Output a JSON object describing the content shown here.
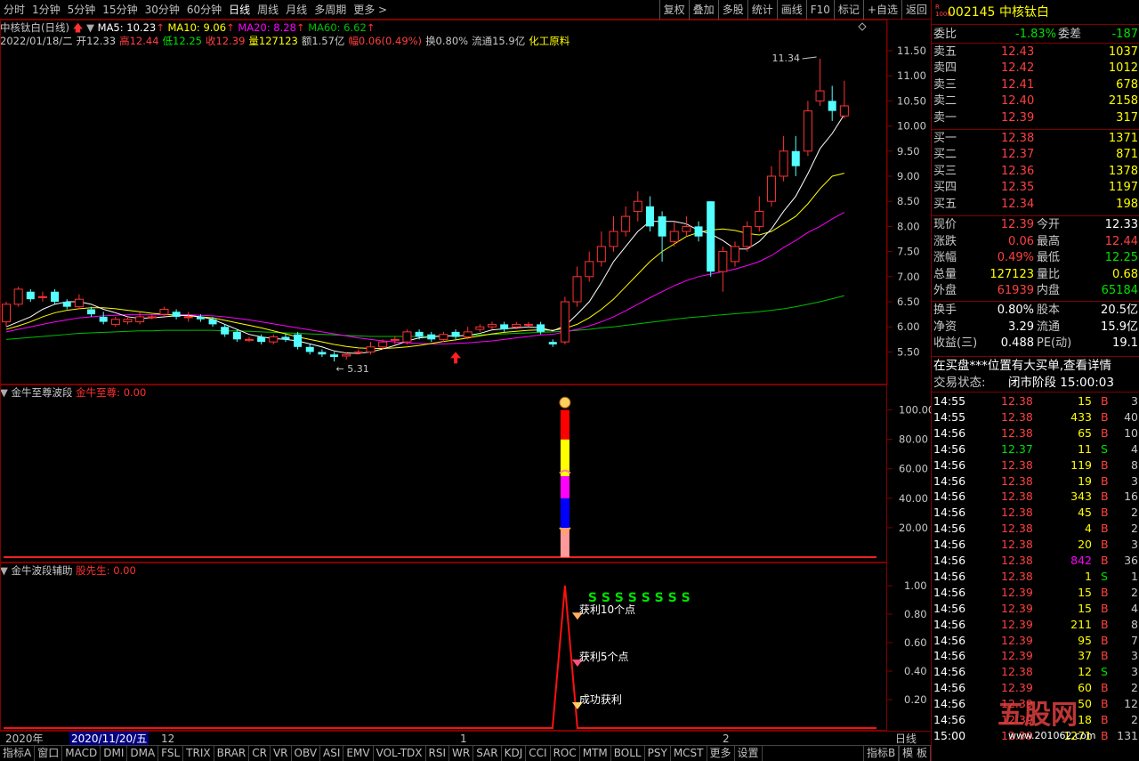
{
  "toolbar": {
    "periods": [
      "分时",
      "1分钟",
      "5分钟",
      "15分钟",
      "30分钟",
      "60分钟",
      "日线",
      "周线",
      "月线",
      "多周期",
      "更多 >"
    ],
    "active": "日线",
    "actions": [
      "复权",
      "叠加",
      "多股",
      "统计",
      "画线",
      "F10",
      "标记",
      "+自选",
      "返回"
    ]
  },
  "chart_header": {
    "name": "中核钛白(日线)",
    "ma5": "MA5: 10.23",
    "ma10": "MA10: 9.06",
    "ma20": "MA20: 8.28",
    "ma60": "MA60: 6.62",
    "info_line": [
      {
        "t": "2022/01/18/二",
        "c": "#c8c8c8"
      },
      {
        "t": "开12.33",
        "c": "#c8c8c8"
      },
      {
        "t": "高12.44",
        "c": "#ff4040"
      },
      {
        "t": "低12.25",
        "c": "#00e000"
      },
      {
        "t": "收12.39",
        "c": "#ff4040"
      },
      {
        "t": "量127123",
        "c": "#ffff00"
      },
      {
        "t": "额1.57亿",
        "c": "#c8c8c8"
      },
      {
        "t": "幅0.06(0.49%)",
        "c": "#ff4040"
      },
      {
        "t": "换0.80%",
        "c": "#c8c8c8"
      },
      {
        "t": "流通15.9亿",
        "c": "#c8c8c8"
      },
      {
        "t": "化工原料",
        "c": "#ffff00"
      }
    ],
    "high_label": "11.34",
    "low_label": "5.31"
  },
  "colors": {
    "up": "#ff3232",
    "down": "#54ffff",
    "ma5": "#ffffff",
    "ma10": "#ffff00",
    "ma20": "#ff00ff",
    "ma60": "#00c000",
    "frame": "#800000"
  },
  "chart_data": [
    {
      "type": "candlestick",
      "y_ticks": [
        11.5,
        11.0,
        10.5,
        10.0,
        9.5,
        9.0,
        8.5,
        8.0,
        7.5,
        7.0,
        6.5,
        6.0,
        5.5
      ],
      "ylim": [
        5.1,
        11.8
      ],
      "candles": [
        [
          6.1,
          6.45,
          6.5,
          6.0
        ],
        [
          6.45,
          6.75,
          6.8,
          6.4
        ],
        [
          6.7,
          6.55,
          6.75,
          6.5
        ],
        [
          6.6,
          6.6,
          6.7,
          6.5
        ],
        [
          6.7,
          6.5,
          6.75,
          6.45
        ],
        [
          6.5,
          6.4,
          6.55,
          6.35
        ],
        [
          6.4,
          6.55,
          6.65,
          6.35
        ],
        [
          6.35,
          6.25,
          6.4,
          6.2
        ],
        [
          6.2,
          6.1,
          6.3,
          6.05
        ],
        [
          6.05,
          6.15,
          6.2,
          6.0
        ],
        [
          6.1,
          6.15,
          6.2,
          6.05
        ],
        [
          6.1,
          6.2,
          6.3,
          6.05
        ],
        [
          6.2,
          6.2,
          6.25,
          6.15
        ],
        [
          6.25,
          6.35,
          6.4,
          6.2
        ],
        [
          6.3,
          6.2,
          6.35,
          6.15
        ],
        [
          6.2,
          6.2,
          6.3,
          6.1
        ],
        [
          6.2,
          6.15,
          6.25,
          6.1
        ],
        [
          6.15,
          6.05,
          6.2,
          6.0
        ],
        [
          6.0,
          5.85,
          6.05,
          5.8
        ],
        [
          5.9,
          5.75,
          5.95,
          5.7
        ],
        [
          5.75,
          5.75,
          5.8,
          5.7
        ],
        [
          5.8,
          5.7,
          5.85,
          5.65
        ],
        [
          5.7,
          5.8,
          5.85,
          5.65
        ],
        [
          5.8,
          5.75,
          5.85,
          5.7
        ],
        [
          5.85,
          5.6,
          5.9,
          5.55
        ],
        [
          5.6,
          5.5,
          5.65,
          5.45
        ],
        [
          5.5,
          5.45,
          5.55,
          5.4
        ],
        [
          5.45,
          5.4,
          5.5,
          5.31
        ],
        [
          5.42,
          5.45,
          5.5,
          5.35
        ],
        [
          5.5,
          5.5,
          5.55,
          5.45
        ],
        [
          5.5,
          5.6,
          5.7,
          5.45
        ],
        [
          5.6,
          5.7,
          5.75,
          5.55
        ],
        [
          5.75,
          5.75,
          5.8,
          5.65
        ],
        [
          5.7,
          5.9,
          5.95,
          5.65
        ],
        [
          5.9,
          5.8,
          5.95,
          5.75
        ],
        [
          5.85,
          5.75,
          5.9,
          5.7
        ],
        [
          5.75,
          5.85,
          5.9,
          5.7
        ],
        [
          5.9,
          5.8,
          5.95,
          5.75
        ],
        [
          5.8,
          5.9,
          6.0,
          5.75
        ],
        [
          5.95,
          6.0,
          6.05,
          5.9
        ],
        [
          6.0,
          6.05,
          6.1,
          5.95
        ],
        [
          6.05,
          5.95,
          6.1,
          5.9
        ],
        [
          6.0,
          6.05,
          6.1,
          5.95
        ],
        [
          6.05,
          6.05,
          6.1,
          6.0
        ],
        [
          6.05,
          5.9,
          6.1,
          5.85
        ],
        [
          5.7,
          5.65,
          5.75,
          5.6
        ],
        [
          5.7,
          6.5,
          6.6,
          5.65
        ],
        [
          6.5,
          7.0,
          7.2,
          6.4
        ],
        [
          7.0,
          7.3,
          7.5,
          6.9
        ],
        [
          7.3,
          7.6,
          7.9,
          7.2
        ],
        [
          7.6,
          7.9,
          8.2,
          7.5
        ],
        [
          7.9,
          8.2,
          8.4,
          7.8
        ],
        [
          8.3,
          8.5,
          8.7,
          8.1
        ],
        [
          8.4,
          8.0,
          8.6,
          7.9
        ],
        [
          8.2,
          7.8,
          8.3,
          7.3
        ],
        [
          7.7,
          7.9,
          8.1,
          7.6
        ],
        [
          7.9,
          8.0,
          8.2,
          7.8
        ],
        [
          8.0,
          7.8,
          8.1,
          7.7
        ],
        [
          8.5,
          7.1,
          8.5,
          7.0
        ],
        [
          7.1,
          7.5,
          7.6,
          6.7
        ],
        [
          7.3,
          7.6,
          7.7,
          7.2
        ],
        [
          7.6,
          8.0,
          8.1,
          7.5
        ],
        [
          8.0,
          8.3,
          8.6,
          7.9
        ],
        [
          8.5,
          9.0,
          9.2,
          8.4
        ],
        [
          9.0,
          9.5,
          9.8,
          8.9
        ],
        [
          9.5,
          9.2,
          9.8,
          9.0
        ],
        [
          9.5,
          10.3,
          10.5,
          9.4
        ],
        [
          10.5,
          10.7,
          11.34,
          10.4
        ],
        [
          10.5,
          10.3,
          10.8,
          10.1
        ],
        [
          10.2,
          10.4,
          10.9,
          10.15
        ]
      ],
      "ma5": [
        6.0,
        6.1,
        6.2,
        6.35,
        6.45,
        6.5,
        6.5,
        6.45,
        6.35,
        6.28,
        6.2,
        6.17,
        6.18,
        6.2,
        6.22,
        6.23,
        6.2,
        6.15,
        6.05,
        5.95,
        5.85,
        5.8,
        5.77,
        5.75,
        5.72,
        5.66,
        5.6,
        5.52,
        5.48,
        5.47,
        5.5,
        5.56,
        5.63,
        5.72,
        5.78,
        5.8,
        5.82,
        5.82,
        5.83,
        5.87,
        5.94,
        5.96,
        5.98,
        6.0,
        5.98,
        5.92,
        6.02,
        6.25,
        6.5,
        6.88,
        7.3,
        7.6,
        7.9,
        8.1,
        8.1,
        8.1,
        8.05,
        7.92,
        7.85,
        7.72,
        7.55,
        7.55,
        7.7,
        7.95,
        8.3,
        8.6,
        9.05,
        9.55,
        9.85,
        10.23
      ],
      "ma10": [
        5.95,
        6.02,
        6.1,
        6.2,
        6.28,
        6.33,
        6.36,
        6.38,
        6.38,
        6.36,
        6.33,
        6.3,
        6.27,
        6.25,
        6.23,
        6.22,
        6.2,
        6.18,
        6.13,
        6.08,
        6.03,
        5.98,
        5.92,
        5.86,
        5.8,
        5.75,
        5.7,
        5.65,
        5.61,
        5.58,
        5.57,
        5.57,
        5.58,
        5.6,
        5.63,
        5.67,
        5.71,
        5.74,
        5.78,
        5.82,
        5.86,
        5.89,
        5.91,
        5.93,
        5.94,
        5.93,
        5.97,
        6.05,
        6.18,
        6.35,
        6.55,
        6.8,
        7.05,
        7.3,
        7.5,
        7.65,
        7.8,
        7.88,
        7.93,
        7.95,
        7.92,
        7.86,
        7.83,
        7.9,
        8.05,
        8.2,
        8.45,
        8.75,
        9.0,
        9.06
      ],
      "ma20": [
        5.9,
        5.95,
        6.0,
        6.05,
        6.1,
        6.14,
        6.18,
        6.2,
        6.22,
        6.23,
        6.24,
        6.24,
        6.24,
        6.24,
        6.24,
        6.24,
        6.23,
        6.22,
        6.2,
        6.17,
        6.14,
        6.1,
        6.06,
        6.02,
        5.98,
        5.94,
        5.9,
        5.86,
        5.82,
        5.78,
        5.75,
        5.72,
        5.7,
        5.68,
        5.67,
        5.66,
        5.66,
        5.67,
        5.68,
        5.7,
        5.72,
        5.75,
        5.78,
        5.81,
        5.84,
        5.85,
        5.9,
        5.95,
        6.02,
        6.1,
        6.2,
        6.32,
        6.45,
        6.58,
        6.7,
        6.82,
        6.92,
        7.0,
        7.05,
        7.1,
        7.15,
        7.22,
        7.3,
        7.42,
        7.58,
        7.72,
        7.88,
        8.0,
        8.15,
        8.28
      ],
      "ma60": [
        5.75,
        5.77,
        5.79,
        5.81,
        5.83,
        5.85,
        5.87,
        5.88,
        5.89,
        5.9,
        5.91,
        5.92,
        5.92,
        5.93,
        5.93,
        5.93,
        5.93,
        5.93,
        5.92,
        5.92,
        5.91,
        5.9,
        5.89,
        5.88,
        5.87,
        5.86,
        5.85,
        5.84,
        5.83,
        5.82,
        5.81,
        5.81,
        5.81,
        5.81,
        5.81,
        5.81,
        5.82,
        5.82,
        5.83,
        5.84,
        5.85,
        5.86,
        5.87,
        5.88,
        5.89,
        5.9,
        5.91,
        5.93,
        5.95,
        5.98,
        6.0,
        6.03,
        6.06,
        6.09,
        6.12,
        6.15,
        6.18,
        6.2,
        6.22,
        6.24,
        6.26,
        6.28,
        6.3,
        6.33,
        6.36,
        6.4,
        6.45,
        6.5,
        6.56,
        6.62
      ]
    },
    {
      "type": "bar",
      "title": "金牛至尊波段",
      "series_label": "金牛至尊: 0.00",
      "y_ticks": [
        100.0,
        80.0,
        60.0,
        40.0,
        20.0
      ],
      "ylim": [
        0,
        110
      ],
      "bar_segments": [
        {
          "from": 0,
          "to": 20,
          "c": "#ff9a9a"
        },
        {
          "from": 20,
          "to": 40,
          "c": "#0000ff"
        },
        {
          "from": 40,
          "to": 55,
          "c": "#ff00ff"
        },
        {
          "from": 55,
          "to": 80,
          "c": "#ffff00"
        },
        {
          "from": 80,
          "to": 100,
          "c": "#ff0000"
        }
      ],
      "bar_index": 46
    },
    {
      "type": "line",
      "title": "金牛波段辅助",
      "series_label": "股先生: 0.00",
      "y_ticks": [
        1.0,
        0.8,
        0.6,
        0.4,
        0.2
      ],
      "ylim": [
        0,
        1.05
      ],
      "peak_index": 46,
      "peak_value": 1.0,
      "s_text": "S S S S S S S S",
      "annotations": [
        {
          "label": "获利10个点",
          "y": 0.78
        },
        {
          "label": "获利5个点",
          "y": 0.45
        },
        {
          "label": "成功获利",
          "y": 0.15
        }
      ]
    }
  ],
  "x_axis": {
    "labels": [
      "2020年",
      "2020/11/20/五",
      "12",
      "1",
      "2"
    ],
    "period": "日线"
  },
  "bottom_tabs": [
    "指标A",
    "窗口",
    "MACD",
    "DMI",
    "DMA",
    "FSL",
    "TRIX",
    "BRAR",
    "CR",
    "VR",
    "OBV",
    "ASI",
    "EMV",
    "VOL-TDX",
    "RSI",
    "WR",
    "SAR",
    "KDJ",
    "CCI",
    "ROC",
    "MTM",
    "BOLL",
    "PSY",
    "MCST",
    "更多",
    "设置"
  ],
  "bottom_right": [
    "指标B",
    "模 板"
  ],
  "quote": {
    "code": "002145",
    "name": "中核钛白",
    "weibi_label": "委比",
    "weibi": "-1.83%",
    "weicha_label": "委差",
    "weicha": "-187",
    "asks": [
      {
        "l": "卖五",
        "p": "12.43",
        "v": "1037"
      },
      {
        "l": "卖四",
        "p": "12.42",
        "v": "1012"
      },
      {
        "l": "卖三",
        "p": "12.41",
        "v": "678"
      },
      {
        "l": "卖二",
        "p": "12.40",
        "v": "2158"
      },
      {
        "l": "卖一",
        "p": "12.39",
        "v": "317"
      }
    ],
    "bids": [
      {
        "l": "买一",
        "p": "12.38",
        "v": "1371"
      },
      {
        "l": "买二",
        "p": "12.37",
        "v": "871"
      },
      {
        "l": "买三",
        "p": "12.36",
        "v": "1378"
      },
      {
        "l": "买四",
        "p": "12.35",
        "v": "1197"
      },
      {
        "l": "买五",
        "p": "12.34",
        "v": "198"
      }
    ],
    "stats": [
      {
        "l1": "现价",
        "v1": "12.39",
        "c1": "#ff4040",
        "l2": "今开",
        "v2": "12.33",
        "c2": "#ffffff"
      },
      {
        "l1": "涨跌",
        "v1": "0.06",
        "c1": "#ff4040",
        "l2": "最高",
        "v2": "12.44",
        "c2": "#ff4040"
      },
      {
        "l1": "涨幅",
        "v1": "0.49%",
        "c1": "#ff4040",
        "l2": "最低",
        "v2": "12.25",
        "c2": "#00e000"
      },
      {
        "l1": "总量",
        "v1": "127123",
        "c1": "#ffff00",
        "l2": "量比",
        "v2": "0.68",
        "c2": "#ffff00"
      },
      {
        "l1": "外盘",
        "v1": "61939",
        "c1": "#ff4040",
        "l2": "内盘",
        "v2": "65184",
        "c2": "#00e000"
      },
      {
        "l1": "换手",
        "v1": "0.80%",
        "c1": "#ffffff",
        "l2": "股本",
        "v2": "20.5亿",
        "c2": "#ffffff"
      },
      {
        "l1": "净资",
        "v1": "3.29",
        "c1": "#ffffff",
        "l2": "流通",
        "v2": "15.9亿",
        "c2": "#ffffff"
      },
      {
        "l1": "收益(三)",
        "v1": "0.488",
        "c1": "#ffffff",
        "l2": "PE(动)",
        "v2": "19.1",
        "c2": "#ffffff"
      }
    ],
    "notice": "在买盘***位置有大买单,查看详情",
    "status_label": "交易状态:",
    "status": "闭市阶段 15:00:03",
    "ticks": [
      [
        "14:55",
        "12.38",
        "15",
        "B",
        "3"
      ],
      [
        "14:55",
        "12.38",
        "433",
        "B",
        "40"
      ],
      [
        "14:56",
        "12.38",
        "65",
        "B",
        "10"
      ],
      [
        "14:56",
        "12.37",
        "11",
        "S",
        "4"
      ],
      [
        "14:56",
        "12.38",
        "119",
        "B",
        "8"
      ],
      [
        "14:56",
        "12.38",
        "19",
        "B",
        "3"
      ],
      [
        "14:56",
        "12.38",
        "343",
        "B",
        "16"
      ],
      [
        "14:56",
        "12.38",
        "45",
        "B",
        "2"
      ],
      [
        "14:56",
        "12.38",
        "4",
        "B",
        "2"
      ],
      [
        "14:56",
        "12.38",
        "20",
        "B",
        "3"
      ],
      [
        "14:56",
        "12.38",
        "842",
        "B",
        "36"
      ],
      [
        "14:56",
        "12.38",
        "1",
        "S",
        "1"
      ],
      [
        "14:56",
        "12.39",
        "15",
        "B",
        "2"
      ],
      [
        "14:56",
        "12.39",
        "15",
        "B",
        "4"
      ],
      [
        "14:56",
        "12.39",
        "211",
        "B",
        "8"
      ],
      [
        "14:56",
        "12.39",
        "95",
        "B",
        "7"
      ],
      [
        "14:56",
        "12.39",
        "37",
        "B",
        "3"
      ],
      [
        "14:56",
        "12.38",
        "12",
        "S",
        "3"
      ],
      [
        "14:56",
        "12.39",
        "60",
        "B",
        "2"
      ],
      [
        "14:56",
        "12.39",
        "50",
        "B",
        "12"
      ],
      [
        "14:56",
        "12.39",
        "18",
        "B",
        "2"
      ],
      [
        "15:00",
        "12.39",
        "1271",
        "B",
        "131"
      ]
    ]
  },
  "watermark": {
    "brand": "五股网",
    "url": "www.201062.com"
  }
}
